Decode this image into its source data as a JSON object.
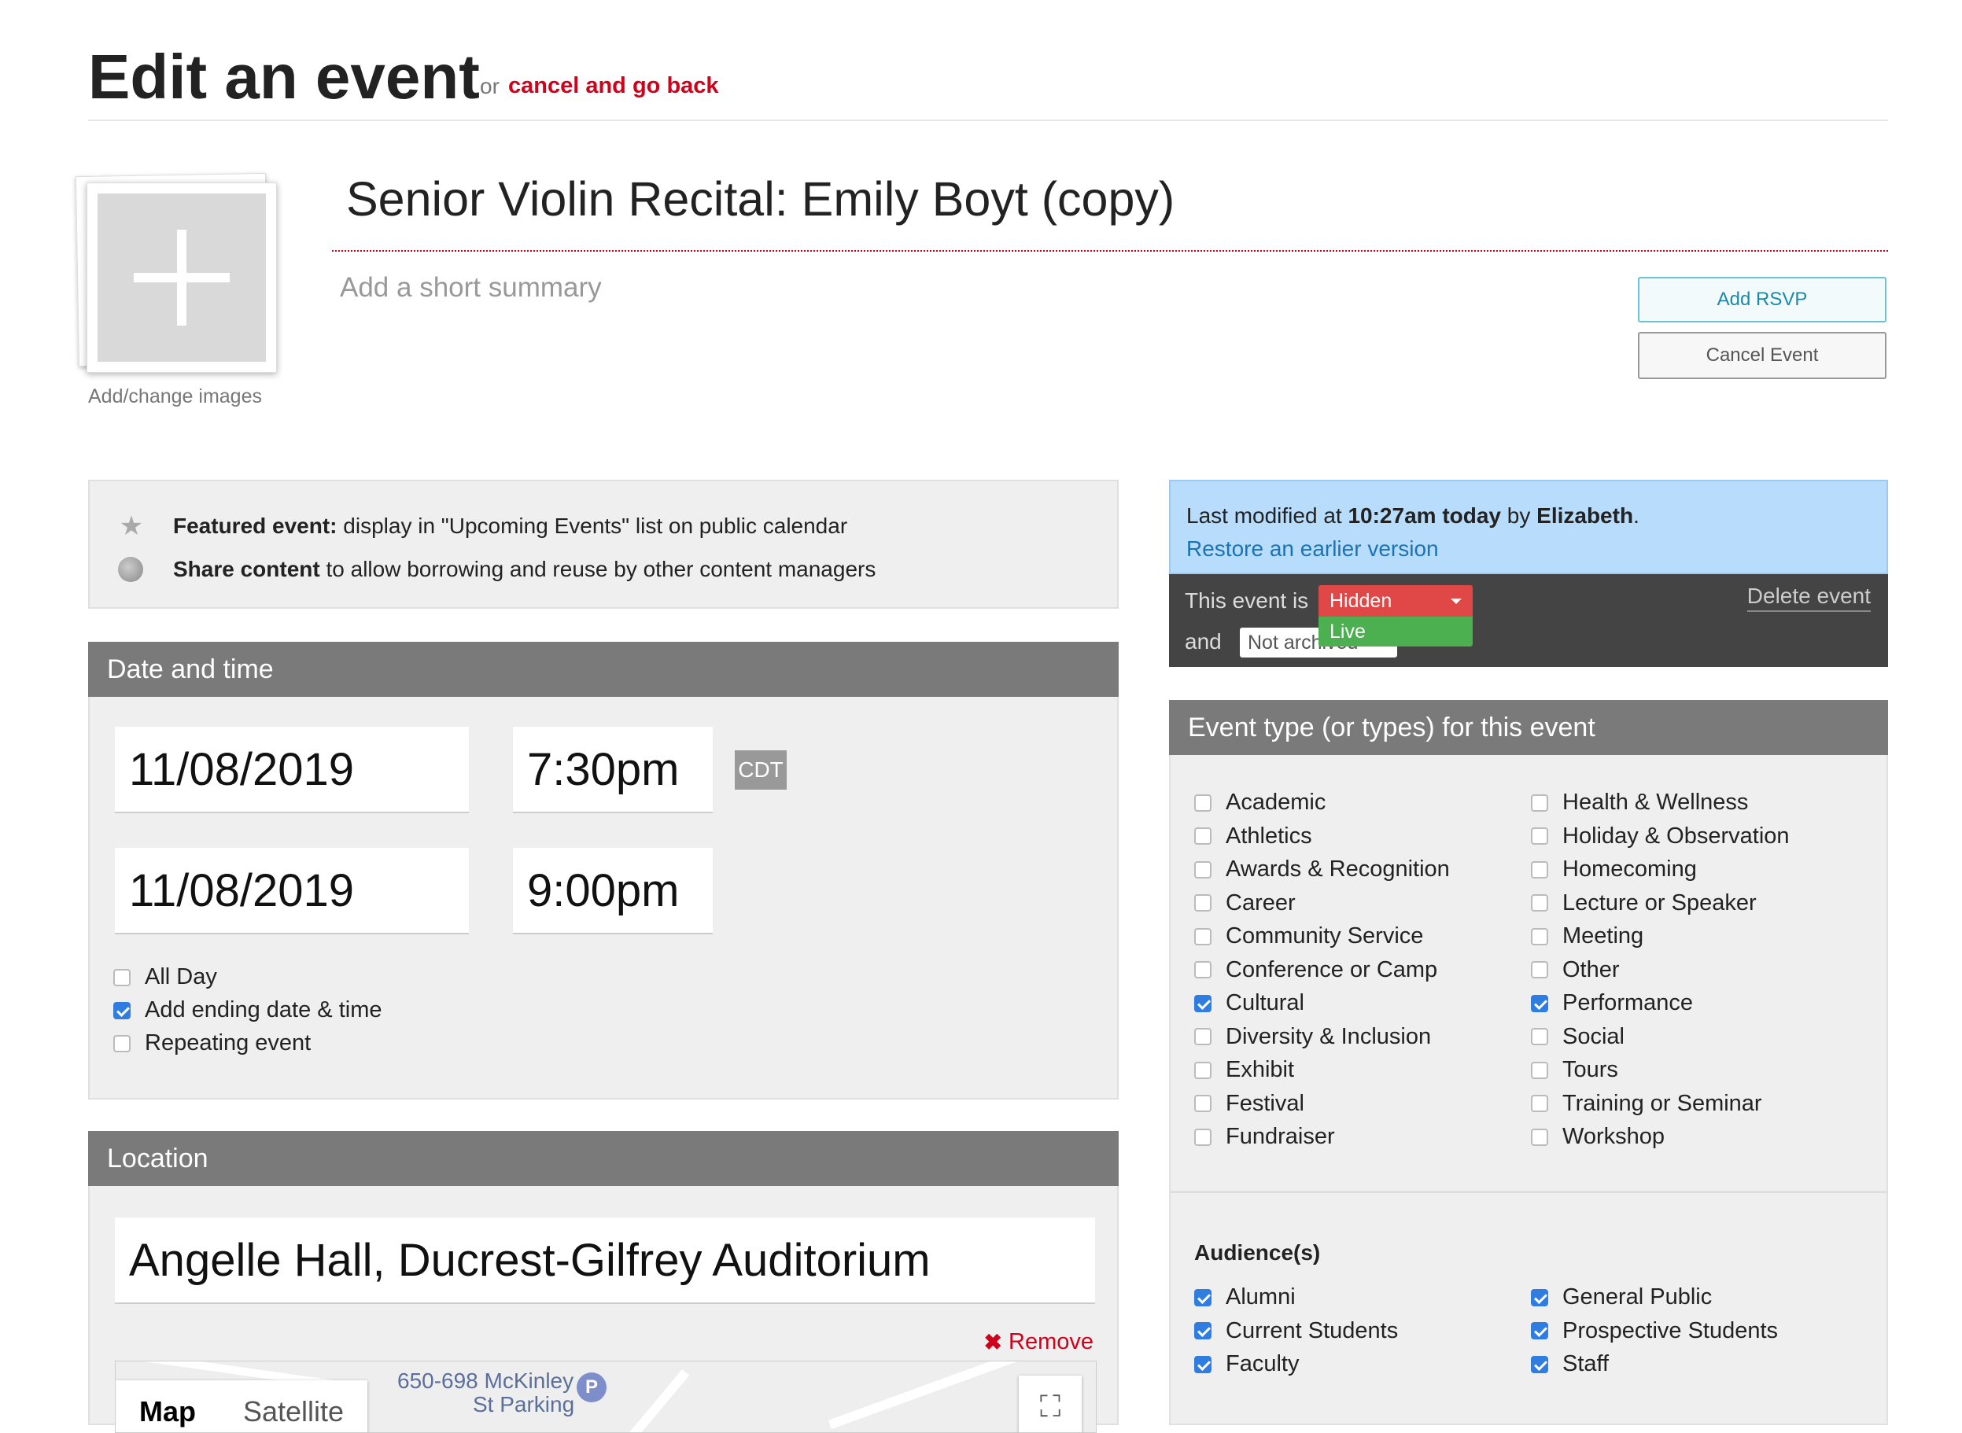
{
  "header": {
    "title": "Edit an event",
    "or_text": "or",
    "cancel_link": "cancel and go back"
  },
  "image": {
    "caption": "Add/change images"
  },
  "event": {
    "title": "Senior Violin Recital: Emily Boyt (copy)",
    "summary_placeholder": "Add a short summary"
  },
  "actions": {
    "add_rsvp": "Add RSVP",
    "cancel_event": "Cancel Event"
  },
  "featured": {
    "featured_bold": "Featured event:",
    "featured_text": "display in \"Upcoming Events\" list on public calendar",
    "share_bold": "Share content",
    "share_text": "to allow borrowing and reuse by other content managers"
  },
  "date_time": {
    "heading": "Date and time",
    "start_date": "11/08/2019",
    "start_time": "7:30pm",
    "timezone": "CDT",
    "end_date": "11/08/2019",
    "end_time": "9:00pm",
    "options": [
      {
        "label": "All Day",
        "checked": false
      },
      {
        "label": "Add ending date & time",
        "checked": true
      },
      {
        "label": "Repeating event",
        "checked": false
      }
    ]
  },
  "location": {
    "heading": "Location",
    "value": "Angelle Hall, Ducrest-Gilfrey Auditorium",
    "remove": "Remove",
    "map_tab": "Map",
    "satellite_tab": "Satellite",
    "map_label_1": "650-698 McKinley",
    "map_label_2": "St Parking",
    "parking_icon": "P"
  },
  "status": {
    "modified_prefix": "Last modified at",
    "modified_time": "10:27am today",
    "modified_by_word": "by",
    "modified_user": "Elizabeth",
    "modified_period": ".",
    "restore": "Restore an earlier version",
    "event_is": "This event is",
    "visibility_selected": "Hidden",
    "visibility_option": "Live",
    "and": "and",
    "archive_selected": "Not archived",
    "delete": "Delete event",
    "colors": {
      "hidden": "#e04848",
      "live": "#4caf50"
    }
  },
  "event_types": {
    "heading": "Event type (or types) for this event",
    "left": [
      {
        "label": "Academic",
        "checked": false
      },
      {
        "label": "Athletics",
        "checked": false
      },
      {
        "label": "Awards & Recognition",
        "checked": false
      },
      {
        "label": "Career",
        "checked": false
      },
      {
        "label": "Community Service",
        "checked": false
      },
      {
        "label": "Conference or Camp",
        "checked": false
      },
      {
        "label": "Cultural",
        "checked": true
      },
      {
        "label": "Diversity & Inclusion",
        "checked": false
      },
      {
        "label": "Exhibit",
        "checked": false
      },
      {
        "label": "Festival",
        "checked": false
      },
      {
        "label": "Fundraiser",
        "checked": false
      }
    ],
    "right": [
      {
        "label": "Health & Wellness",
        "checked": false
      },
      {
        "label": "Holiday & Observation",
        "checked": false
      },
      {
        "label": "Homecoming",
        "checked": false
      },
      {
        "label": "Lecture or Speaker",
        "checked": false
      },
      {
        "label": "Meeting",
        "checked": false
      },
      {
        "label": "Other",
        "checked": false
      },
      {
        "label": "Performance",
        "checked": true
      },
      {
        "label": "Social",
        "checked": false
      },
      {
        "label": "Tours",
        "checked": false
      },
      {
        "label": "Training or Seminar",
        "checked": false
      },
      {
        "label": "Workshop",
        "checked": false
      }
    ]
  },
  "audiences": {
    "heading": "Audience(s)",
    "left": [
      {
        "label": "Alumni",
        "checked": true
      },
      {
        "label": "Current Students",
        "checked": true
      },
      {
        "label": "Faculty",
        "checked": true
      }
    ],
    "right": [
      {
        "label": "General Public",
        "checked": true
      },
      {
        "label": "Prospective Students",
        "checked": true
      },
      {
        "label": "Staff",
        "checked": true
      }
    ]
  }
}
